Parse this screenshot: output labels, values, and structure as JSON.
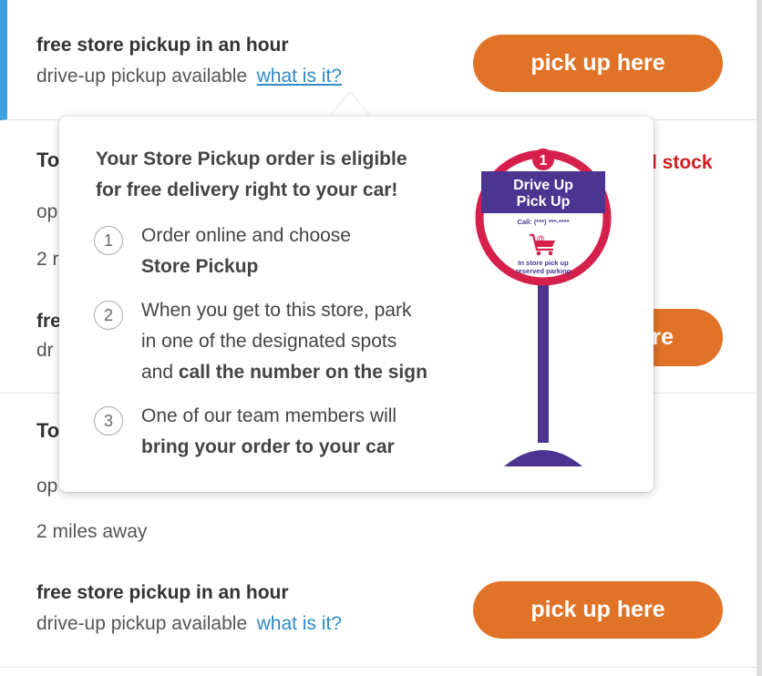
{
  "stores": [
    {
      "pickup_title": "free store pickup in an hour",
      "drive_up_text": "drive-up pickup available",
      "what_link": "what is it?",
      "button": "pick up here"
    },
    {
      "name_partial": "To",
      "stock_partial": "l stock",
      "line2_partial": "op",
      "distance_partial": "2 r",
      "pickup_partial": "fre",
      "drive_partial": "dr",
      "button_partial": "re"
    },
    {
      "name_partial": "To",
      "line2_partial": "op",
      "distance": "2 miles away",
      "pickup_title": "free store pickup in an hour",
      "drive_up_text": "drive-up pickup available",
      "what_link": "what is it?",
      "button": "pick up here"
    }
  ],
  "tooltip": {
    "heading_line1": "Your Store Pickup order is eligible",
    "heading_line2": "for free delivery right to your car!",
    "steps": [
      {
        "num": "1",
        "line1": "Order online and choose",
        "bold": "Store Pickup"
      },
      {
        "num": "2",
        "line1": "When you get to this store, park",
        "line2": "in one of the designated spots",
        "line3_plain": "and ",
        "line3_bold": "call the number on the sign"
      },
      {
        "num": "3",
        "line1": "One of our team members will",
        "bold": "bring your order to your car"
      }
    ],
    "sign": {
      "badge": "1",
      "title_line1": "Drive Up",
      "title_line2": "Pick Up",
      "call": "Call: (***) ***-****",
      "at_symbol": "@",
      "footer_line1": "In store pick up",
      "footer_line2": "reserved parking",
      "colors": {
        "ring": "#d6204c",
        "purple": "#4b3591"
      }
    }
  },
  "colors": {
    "accent_blue": "#3d9fdc",
    "button_orange": "#e07327",
    "link_blue": "#2c8bc7",
    "stock_red": "#cc1f1f"
  }
}
